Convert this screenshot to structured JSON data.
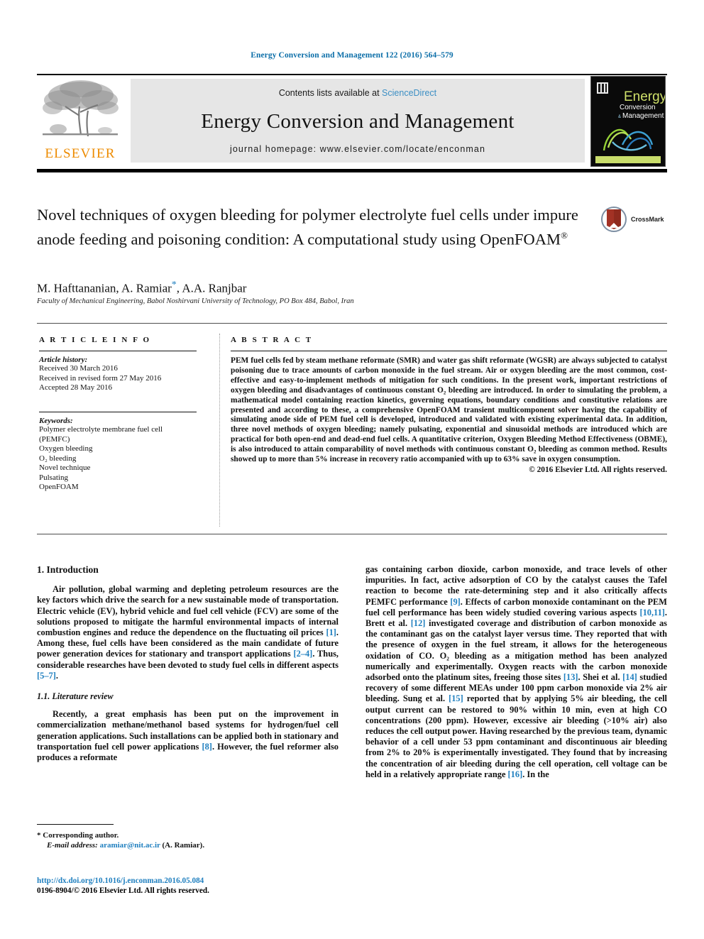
{
  "running_head": "Energy Conversion and Management 122 (2016) 564–579",
  "masthead": {
    "publisher_name": "ELSEVIER",
    "contents_prefix": "Contents lists available at ",
    "sciencedirect": "ScienceDirect",
    "journal_name": "Energy Conversion and Management",
    "homepage": "journal homepage: www.elsevier.com/locate/enconman",
    "cover": {
      "line1": "Energy",
      "line2": "Conversion",
      "line3": "Management",
      "ampersand": "&"
    }
  },
  "article": {
    "title": "Novel techniques of oxygen bleeding for polymer electrolyte fuel cells under impure anode feeding and poisoning condition: A computational study using OpenFOAM",
    "title_sup": "®",
    "authors": "M. Hafttananian, A. Ramiar, A.A. Ranjbar",
    "corresponding_marker": "*",
    "affiliation": "Faculty of Mechanical Engineering, Babol Noshirvani University of Technology, PO Box 484, Babol, Iran",
    "crossmark_label": "CrossMark"
  },
  "info": {
    "heading": "A R T I C L E   I N F O",
    "history_label": "Article history:",
    "history": [
      "Received 30 March 2016",
      "Received in revised form 27 May 2016",
      "Accepted 28 May 2016"
    ],
    "keywords_label": "Keywords:",
    "keywords": [
      "Polymer electrolyte membrane fuel cell",
      "(PEMFC)",
      "Oxygen bleeding",
      "O₂ bleeding",
      "Novel technique",
      "Pulsating",
      "OpenFOAM"
    ]
  },
  "abstract": {
    "heading": "A B S T R A C T",
    "body": "PEM fuel cells fed by steam methane reformate (SMR) and water gas shift reformate (WGSR) are always subjected to catalyst poisoning due to trace amounts of carbon monoxide in the fuel stream. Air or oxygen bleeding are the most common, cost-effective and easy-to-implement methods of mitigation for such conditions. In the present work, important restrictions of oxygen bleeding and disadvantages of continuous constant O₂ bleeding are introduced. In order to simulating the problem, a mathematical model containing reaction kinetics, governing equations, boundary conditions and constitutive relations are presented and according to these, a comprehensive OpenFOAM transient multicomponent solver having the capability of simulating anode side of PEM fuel cell is developed, introduced and validated with existing experimental data. In addition, three novel methods of oxygen bleeding; namely pulsating, exponential and sinusoidal methods are introduced which are practical for both open-end and dead-end fuel cells. A quantitative criterion, Oxygen Bleeding Method Effectiveness (OBME), is also introduced to attain comparability of novel methods with continuous constant O₂ bleeding as common method. Results showed up to more than 5% increase in recovery ratio accompanied with up to 63% save in oxygen consumption.",
    "copyright": "© 2016 Elsevier Ltd. All rights reserved."
  },
  "body": {
    "section1_heading": "1. Introduction",
    "section1_para1_a": "Air pollution, global warming and depleting petroleum resources are the key factors which drive the search for a new sustainable mode of transportation. Electric vehicle (EV), hybrid vehicle and fuel cell vehicle (FCV) are some of the solutions proposed to mitigate the harmful environmental impacts of internal combustion engines and reduce the dependence on the fluctuating oil prices ",
    "ref1": "[1]",
    "section1_para1_b": ". Among these, fuel cells have been considered as the main candidate of future power generation devices for stationary and transport applications ",
    "ref2": "[2–4]",
    "section1_para1_c": ". Thus, considerable researches have been devoted to study fuel cells in different aspects ",
    "ref3": "[5–7]",
    "section1_para1_d": ".",
    "section11_heading": "1.1. Literature review",
    "section11_para_a": "Recently, a great emphasis has been put on the improvement in commercialization methane/methanol based systems for hydrogen/fuel cell generation applications. Such installations can be applied both in stationary and transportation fuel cell power applications ",
    "ref8": "[8]",
    "section11_para_b": ". However, the fuel reformer also produces a reformate",
    "right_para_a": "gas containing carbon dioxide, carbon monoxide, and trace levels of other impurities. In fact, active adsorption of CO by the catalyst causes the Tafel reaction to become the rate-determining step and it also critically affects PEMFC performance ",
    "ref9": "[9]",
    "right_para_b": ". Effects of carbon monoxide contaminant on the PEM fuel cell performance has been widely studied covering various aspects ",
    "ref1011": "[10,11]",
    "right_para_c": ". Brett et al. ",
    "ref12": "[12]",
    "right_para_d": " investigated coverage and distribution of carbon monoxide as the contaminant gas on the catalyst layer versus time. They reported that with the presence of oxygen in the fuel stream, it allows for the heterogeneous oxidation of CO. O₂ bleeding as a mitigation method has been analyzed numerically and experimentally. Oxygen reacts with the carbon monoxide adsorbed onto the platinum sites, freeing those sites ",
    "ref13": "[13]",
    "right_para_e": ". Shei et al. ",
    "ref14": "[14]",
    "right_para_f": " studied recovery of some different MEAs under 100 ppm carbon monoxide via 2% air bleeding. Sung et al. ",
    "ref15": "[15]",
    "right_para_g": " reported that by applying 5% air bleeding, the cell output current can be restored to 90% within 10 min, even at high CO concentrations (200 ppm). However, excessive air bleeding (>10% air) also reduces the cell output power. Having researched by the previous team, dynamic behavior of a cell under 53 ppm contaminant and discontinuous air bleeding from 2% to 20% is experimentally investigated. They found that by increasing the concentration of air bleeding during the cell operation, cell voltage can be held in a relatively appropriate range ",
    "ref16": "[16]",
    "right_para_h": ". In the"
  },
  "footnote": {
    "corresponding": "* Corresponding author.",
    "email_label": "E-mail address:",
    "email": "aramiar@nit.ac.ir",
    "email_owner": "(A. Ramiar)."
  },
  "colophon": {
    "doi": "http://dx.doi.org/10.1016/j.enconman.2016.05.084",
    "issn_line": "0196-8904/© 2016 Elsevier Ltd. All rights reserved."
  },
  "colors": {
    "link_blue": "#1f7fbf",
    "header_blue": "#0b6ea8",
    "elsevier_orange": "#ed8b00",
    "band_gray": "#e6e6e6"
  }
}
